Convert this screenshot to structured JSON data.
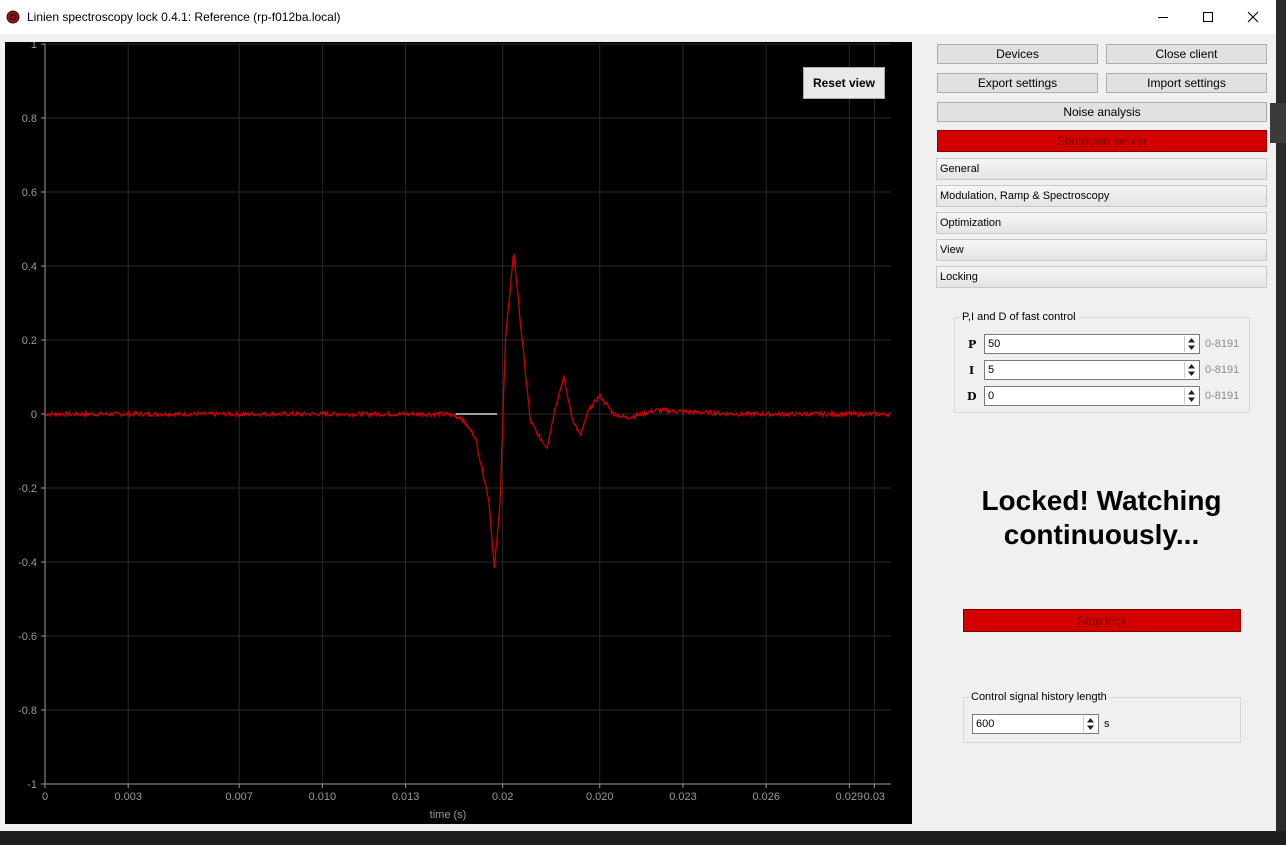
{
  "window": {
    "title": "Linien spectroscopy lock 0.4.1: Reference (rp-f012ba.local)",
    "icon": "linien-logo-icon"
  },
  "toolbar": {
    "devices": "Devices",
    "close_client": "Close client",
    "export_settings": "Export settings",
    "import_settings": "Import settings",
    "noise_analysis": "Noise analysis",
    "shutdown_server": "Shutdown server"
  },
  "sections": [
    "General",
    "Modulation, Ramp & Spectroscopy",
    "Optimization",
    "View",
    "Locking"
  ],
  "pid": {
    "group_title": "P,I and D  of fast control",
    "p_label": "P",
    "p_value": "50",
    "i_label": "I",
    "i_value": "5",
    "d_label": "D",
    "d_value": "0",
    "range": "0-8191"
  },
  "status": {
    "line1": "Locked! Watching",
    "line2": "continuously..."
  },
  "stop_lock": "Stop lock",
  "history": {
    "group_title": "Control signal history length",
    "value": "600",
    "unit": "s"
  },
  "plot": {
    "reset_view": "Reset view"
  },
  "colors": {
    "signal": "#cc0000",
    "accent_red": "#d30000",
    "plot_bg": "#000000"
  },
  "chart_data": {
    "type": "line",
    "xlabel": "time (s)",
    "ylabel": "",
    "xlim": [
      0,
      0.0305
    ],
    "ylim": [
      -1,
      1
    ],
    "x_ticks": [
      "0",
      "0.003",
      "0.007",
      "0.010",
      "0.013",
      "0.02",
      "0.020",
      "0.023",
      "0.026",
      "0.029",
      "0.03"
    ],
    "y_ticks": [
      "1",
      "0.8",
      "0.6",
      "0.4",
      "0.2",
      "0",
      "-0.2",
      "-0.4",
      "-0.6",
      "-0.8",
      "-1"
    ],
    "grid": true,
    "series": [
      {
        "color": "#cc0000",
        "x": [
          0,
          0.005,
          0.01,
          0.0145,
          0.015,
          0.0155,
          0.016,
          0.0162,
          0.0164,
          0.0166,
          0.0169,
          0.0172,
          0.0175,
          0.0178,
          0.0181,
          0.0184,
          0.0187,
          0.019,
          0.0193,
          0.0196,
          0.02,
          0.0205,
          0.021,
          0.022,
          0.025,
          0.0305
        ],
        "y": [
          0,
          0,
          0,
          0,
          -0.01,
          -0.06,
          -0.23,
          -0.42,
          -0.25,
          0.2,
          0.44,
          0.2,
          -0.02,
          -0.06,
          -0.09,
          0.02,
          0.1,
          -0.01,
          -0.06,
          0.01,
          0.05,
          0.0,
          -0.01,
          0.01,
          0.0,
          0.0
        ]
      }
    ]
  }
}
